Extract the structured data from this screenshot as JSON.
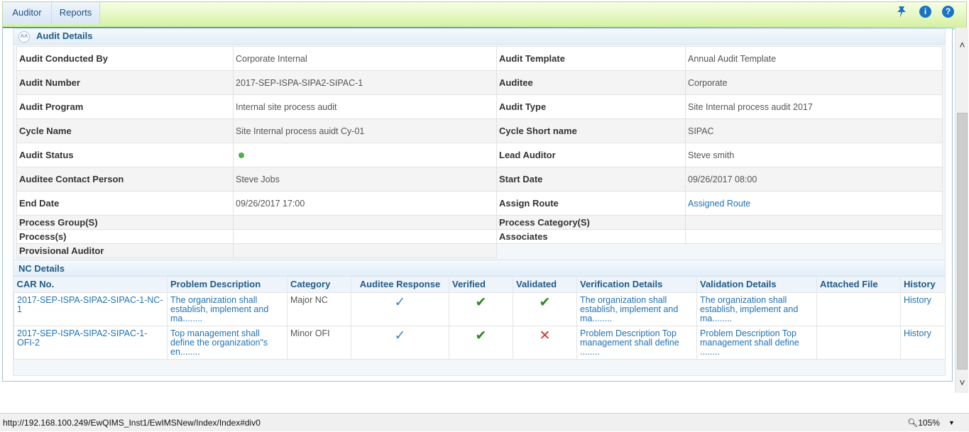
{
  "nav": {
    "tabs": [
      "Auditor",
      "Reports"
    ]
  },
  "audit_details": {
    "title": "Audit Details",
    "rows": [
      [
        "Audit Conducted By",
        "Corporate Internal",
        "Audit Template",
        "Annual Audit Template"
      ],
      [
        "Audit Number",
        "2017-SEP-ISPA-SIPA2-SIPAC-1",
        "Auditee",
        "Corporate"
      ],
      [
        "Audit Program",
        "Internal site process audit",
        "Audit Type",
        "Site Internal process audit 2017"
      ],
      [
        "Cycle Name",
        "Site Internal process auidt Cy-01",
        "Cycle Short name",
        "SIPAC"
      ],
      [
        "Audit Status",
        "",
        "Lead Auditor",
        "Steve smith"
      ],
      [
        "Auditee Contact Person",
        "Steve Jobs",
        "Start Date",
        "09/26/2017 08:00"
      ],
      [
        "End Date",
        "09/26/2017 17:00",
        "Assign Route",
        "Assigned Route"
      ]
    ],
    "short_rows": [
      [
        "Process Group(S)",
        "",
        "Process Category(S)",
        ""
      ],
      [
        "Process(s)",
        "",
        "Associates",
        ""
      ],
      [
        "Provisional Auditor",
        ""
      ]
    ],
    "status_color": "#4db04b"
  },
  "nc_details": {
    "title": "NC Details",
    "columns": [
      "CAR No.",
      "Problem Description",
      "Category",
      "Auditee Response",
      "Verified",
      "Validated",
      "Verification Details",
      "Validation Details",
      "Attached File",
      "History"
    ],
    "rows": [
      {
        "car_no": "2017-SEP-ISPA-SIPA2-SIPAC-1-NC-1",
        "problem": "The organization shall establish, implement and ma........",
        "category": "Major NC",
        "verification": "The organization shall establish, implement and ma........",
        "validation": "The organization shall establish, implement and ma........",
        "history": "History",
        "auditee_response": "check",
        "verified": "check",
        "validated": "check"
      },
      {
        "car_no": "2017-SEP-ISPA-SIPA2-SIPAC-1-OFI-2",
        "problem": "Top management shall define the organization\"s en........",
        "category": "Minor OFI",
        "verification": "Problem Description Top management shall define ........",
        "validation": "Problem Description Top management shall define ........",
        "history": "History",
        "auditee_response": "check",
        "verified": "check",
        "validated": "cross"
      }
    ]
  },
  "statusbar": {
    "url": "http://192.168.100.249/EwQIMS_Inst1/EwIMSNew/Index/Index#div0",
    "zoom": "105%"
  },
  "icons": {
    "pin": "pin-icon",
    "info": "info-icon",
    "help": "help-icon",
    "collapse": "collapse-up-icon",
    "check_blue": "#3a86c8",
    "check_green": "#2a8a1e",
    "cross_red": "#d83030"
  }
}
